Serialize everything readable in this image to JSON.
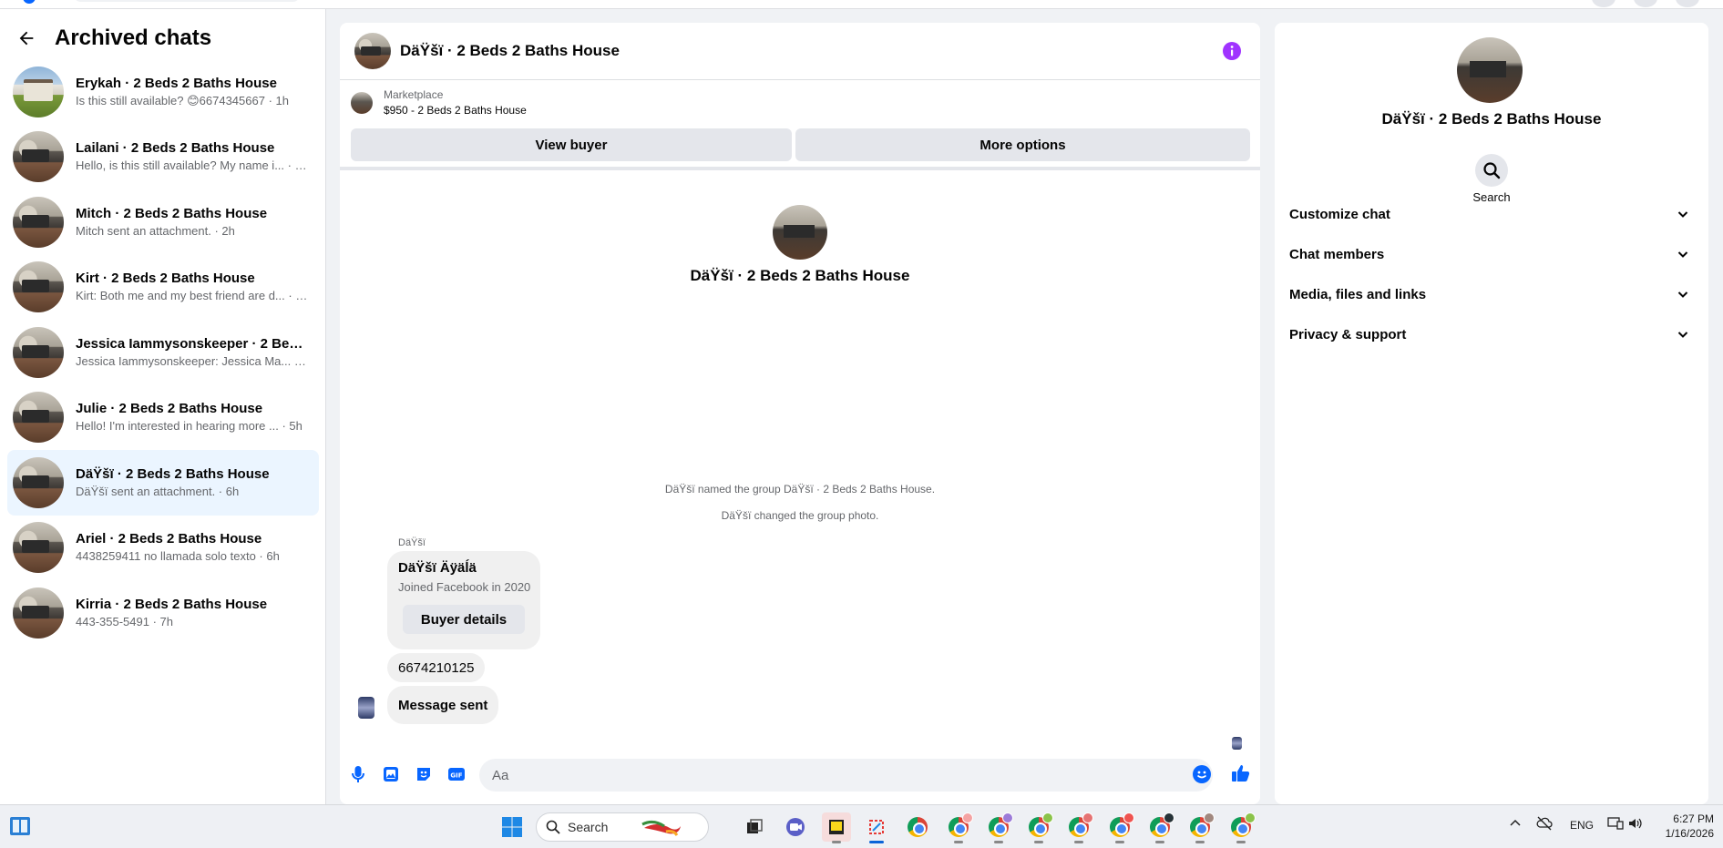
{
  "sidebar": {
    "title": "Archived chats",
    "chats": [
      {
        "name": "Erykah · 2 Beds 2 Baths House",
        "preview": "Is this still available? 😊6674345667 · 1h",
        "avatar": "house"
      },
      {
        "name": "Lailani · 2 Beds 2 Baths House",
        "preview": "Hello, is this still available? My name i... · 2h",
        "avatar": "room"
      },
      {
        "name": "Mitch · 2 Beds 2 Baths House",
        "preview": "Mitch sent an attachment. · 2h",
        "avatar": "room"
      },
      {
        "name": "Kirt · 2 Beds 2 Baths House",
        "preview": "Kirt: Both me and my best friend are d... · 3h",
        "avatar": "room"
      },
      {
        "name": "Jessica Iammysonskeeper · 2 Beds 2 Baths House",
        "preview": "Jessica Iammysonskeeper: Jessica Ma... · 4h",
        "avatar": "room"
      },
      {
        "name": "Julie · 2 Beds 2 Baths House",
        "preview": "Hello! I'm interested in hearing more ... · 5h",
        "avatar": "room"
      },
      {
        "name": "DäŸšï · 2 Beds 2 Baths House",
        "preview": "DäŸšï sent an attachment. · 6h",
        "avatar": "room",
        "active": true
      },
      {
        "name": "Ariel · 2 Beds 2 Baths House",
        "preview": "4438259411 no llamada solo texto · 6h",
        "avatar": "room"
      },
      {
        "name": "Kirria · 2 Beds 2 Baths House",
        "preview": "443-355-5491 · 7h",
        "avatar": "room"
      }
    ]
  },
  "conversation": {
    "title": "DäŸšï · 2 Beds 2 Baths House",
    "marketplace": {
      "label": "Marketplace",
      "listing": "$950 - 2 Beds 2 Baths House",
      "view_buyer": "View buyer",
      "more_options": "More options"
    },
    "intro_name": "DäŸšï · 2 Beds 2 Baths House",
    "system_messages": [
      "DäŸšï named the group DäŸšï · 2 Beds 2 Baths House.",
      "DäŸšï changed the group photo."
    ],
    "sender_label": "DäŸšï",
    "buyer_card": {
      "name": "DäŸšï Äÿäĺä",
      "subtitle": "Joined Facebook in 2020",
      "button": "Buyer details"
    },
    "messages": [
      "6674210125",
      "Message sent"
    ],
    "composer_placeholder": "Aa"
  },
  "info_panel": {
    "name": "DäŸšï · 2 Beds 2 Baths House",
    "search_label": "Search",
    "sections": [
      "Customize chat",
      "Chat members",
      "Media, files and links",
      "Privacy & support"
    ]
  },
  "taskbar": {
    "search_label": "Search",
    "tray": {
      "language": "ENG",
      "time": "6:27 PM",
      "date": "1/16/2026"
    }
  },
  "colors": {
    "accent_purple": "#a033ff",
    "messenger_blue": "#0866ff",
    "active_chat_bg": "#ebf5ff"
  }
}
